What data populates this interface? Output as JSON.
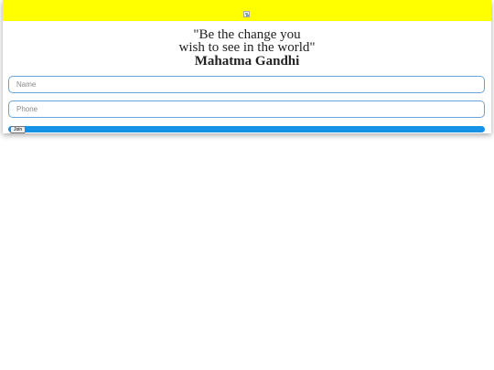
{
  "header": {
    "background_color": "#ffff00",
    "image_state": "broken-image"
  },
  "quote": {
    "line1": "\"Be the change you",
    "line2": "wish to see in the world\"",
    "author": "Mahatma Gandhi"
  },
  "form": {
    "name_placeholder": "Name",
    "name_value": "",
    "phone_placeholder": "Phone",
    "phone_value": "",
    "join_label": "Join"
  },
  "colors": {
    "accent_bar": "#1592e6",
    "input_border": "#6aa3d8"
  }
}
